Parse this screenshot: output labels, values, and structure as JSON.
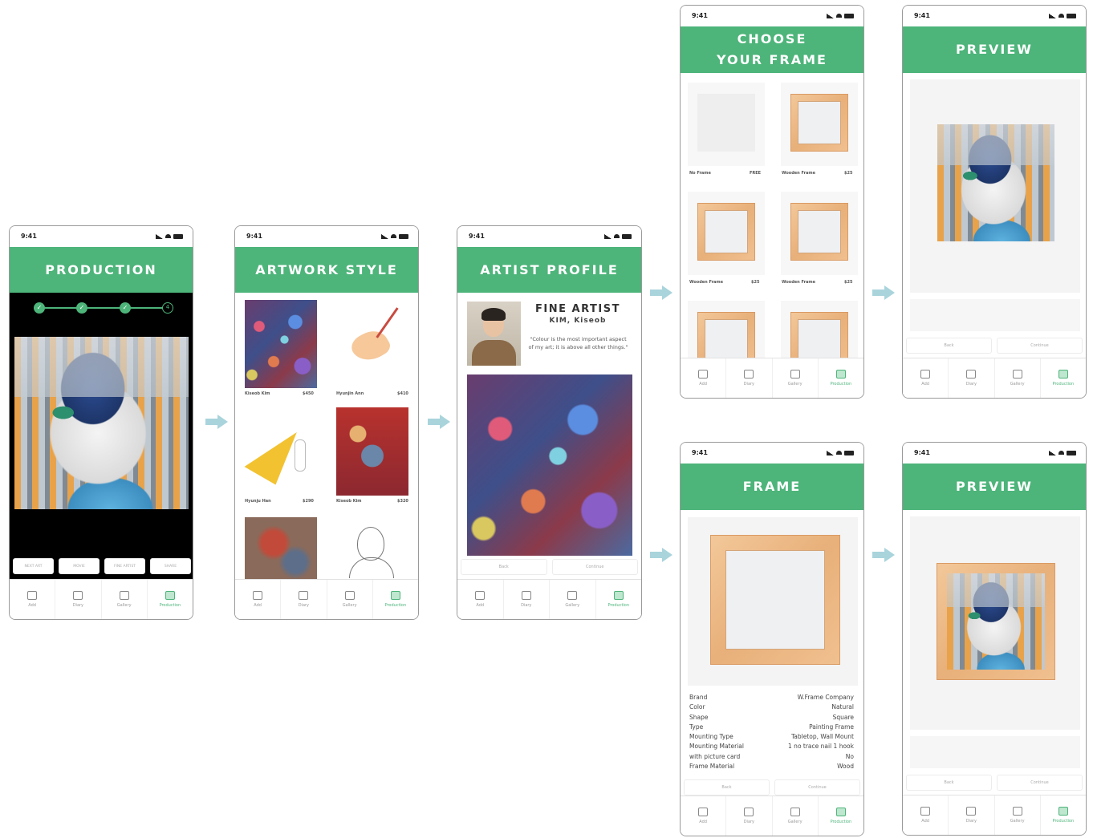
{
  "status_time": "9:41",
  "tabs": {
    "add": "Add",
    "diary": "Diary",
    "gallery": "Gallery",
    "production": "Production"
  },
  "screens": {
    "production": {
      "title": "PRODUCTION",
      "steps": [
        "✓",
        "✓",
        "✓",
        "4"
      ],
      "buttons": [
        "NEXT ART",
        "MOVIE",
        "FINE ARTIST",
        "SHARE"
      ]
    },
    "artwork_style": {
      "title": "ARTWORK STYLE",
      "items": [
        {
          "artist": "Kiseob Kim",
          "price": "$450"
        },
        {
          "artist": "Hyunjin Ann",
          "price": "$410"
        },
        {
          "artist": "Hyunju Han",
          "price": "$290"
        },
        {
          "artist": "Kiseob Kim",
          "price": "$320"
        }
      ]
    },
    "artist_profile": {
      "title": "ARTIST PROFILE",
      "role": "FINE ARTIST",
      "name": "KIM, Kiseob",
      "quote": "\"Colour is the most important aspect of my art; it is above all other things.\"",
      "back": "Back",
      "continue": "Continue"
    },
    "choose_frame": {
      "title_line1": "CHOOSE",
      "title_line2": "YOUR FRAME",
      "options": [
        {
          "name": "No Frame",
          "price": "FREE"
        },
        {
          "name": "Wooden Frame",
          "price": "$25"
        },
        {
          "name": "Wooden Frame",
          "price": "$25"
        },
        {
          "name": "Wooden Frame",
          "price": "$25"
        }
      ]
    },
    "preview_top": {
      "title": "PREVIEW",
      "back": "Back",
      "continue": "Continue"
    },
    "frame": {
      "title": "FRAME",
      "spec_labels": [
        "Brand",
        "Color",
        "Shape",
        "Type",
        "Mounting Type",
        "Mounting Material",
        "with picture card",
        "Frame Material"
      ],
      "spec_values": [
        "W.Frame Company",
        "Natural",
        "Square",
        "Painting Frame",
        "Tabletop, Wall Mount",
        "1 no trace nail 1 hook",
        "No",
        "Wood"
      ],
      "back": "Back",
      "continue": "Continue"
    },
    "preview_bottom": {
      "title": "PREVIEW",
      "back": "Back",
      "continue": "Continue"
    }
  },
  "colors": {
    "header_green": "#4db47a",
    "arrow": "#a9d4dc",
    "wood": "#e8b07a"
  }
}
